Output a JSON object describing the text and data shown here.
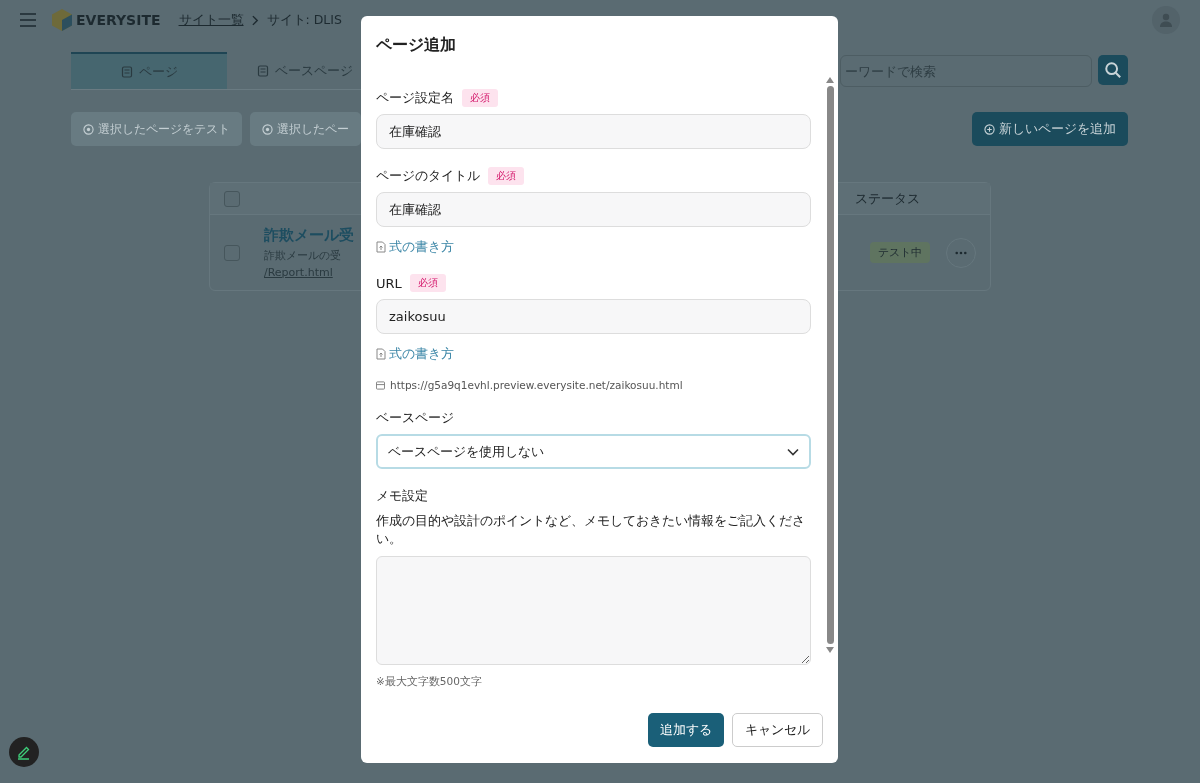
{
  "header": {
    "brand": "EVERYSITE",
    "breadcrumb": [
      {
        "label": "サイト一覧",
        "kind": "link"
      },
      {
        "label": "サイト: DLIS",
        "kind": "text"
      }
    ]
  },
  "tabs": [
    {
      "label": "ページ",
      "selected": true
    },
    {
      "label": "ベースページ",
      "selected": false
    }
  ],
  "search": {
    "placeholder": "ーワードで検索"
  },
  "actions": [
    {
      "label": "選択したページをテスト",
      "disabled": true
    },
    {
      "label": "選択したペー",
      "disabled": true
    }
  ],
  "primary_action": {
    "label": "新しいページを追加"
  },
  "table": {
    "all_checked": false,
    "columns": [
      {
        "label": "ステータス"
      }
    ],
    "rows": [
      {
        "checked": false,
        "title": "詐欺メール受",
        "memo": "詐欺メールの受",
        "url": "/Report.html",
        "status": "テスト中"
      }
    ]
  },
  "dialog": {
    "title": "ページ追加",
    "fields": [
      {
        "kind": "input",
        "label": "ページ設定名",
        "badge": "必須",
        "value": "在庫確認"
      },
      {
        "kind": "input",
        "label": "ページのタイトル",
        "badge": "必須",
        "value": "在庫確認",
        "help": "式の書き方"
      },
      {
        "kind": "input",
        "label": "URL",
        "badge": "必須",
        "value": "zaikosuu",
        "help": "式の書き方",
        "preview": "https://g5a9q1evhl.preview.everysite.net/zaikosuu.html"
      },
      {
        "kind": "select",
        "label": "ベースページ",
        "value": "ベースページを使用しない"
      },
      {
        "kind": "textarea",
        "label": "メモ設定",
        "description": "作成の目的や設計のポイントなど、メモしておきたい情報をご記入ください。",
        "note": "※最大文字数500文字"
      }
    ],
    "buttons": [
      {
        "label": "追加する",
        "kind": "primary"
      },
      {
        "label": "キャンセル",
        "kind": "secondary"
      }
    ]
  }
}
